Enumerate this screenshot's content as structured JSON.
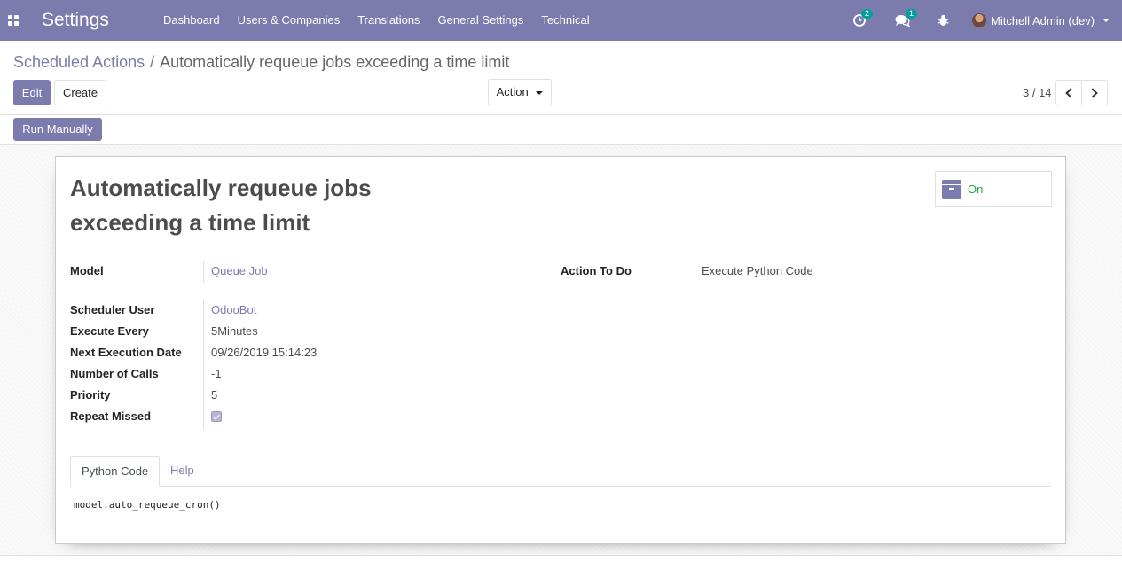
{
  "navbar": {
    "brand": "Settings",
    "menu": [
      "Dashboard",
      "Users & Companies",
      "Translations",
      "General Settings",
      "Technical"
    ],
    "activity_count": "2",
    "messages_count": "1",
    "user": "Mitchell Admin (dev)"
  },
  "breadcrumb": {
    "parent": "Scheduled Actions",
    "separator": "/",
    "current": "Automatically requeue jobs exceeding a time limit"
  },
  "toolbar": {
    "edit": "Edit",
    "create": "Create",
    "action": "Action",
    "pager": "3 / 14"
  },
  "header": {
    "run_manually": "Run Manually"
  },
  "record": {
    "title_line1": "Automatically requeue jobs",
    "title_line2": "exceeding a time limit",
    "active_label": "On",
    "fields": {
      "model_label": "Model",
      "model_value": "Queue Job",
      "action_label": "Action To Do",
      "action_value": "Execute Python Code",
      "user_label": "Scheduler User",
      "user_value": "OdooBot",
      "interval_label": "Execute Every",
      "interval_value": "5Minutes",
      "nextcall_label": "Next Execution Date",
      "nextcall_value": "09/26/2019 15:14:23",
      "numbercall_label": "Number of Calls",
      "numbercall_value": "-1",
      "priority_label": "Priority",
      "priority_value": "5",
      "repeat_label": "Repeat Missed",
      "repeat_checked": true
    },
    "tabs": [
      "Python Code",
      "Help"
    ],
    "code": "model.auto_requeue_cron()"
  },
  "colors": {
    "brand": "#7c7bad",
    "on_status": "#28a745",
    "badge": "#00a09d"
  }
}
